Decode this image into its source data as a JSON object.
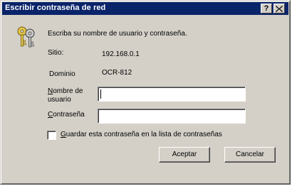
{
  "window": {
    "title": "Escribir contraseña de red",
    "help_button": "?",
    "close_button": "×"
  },
  "instruction": "Escriba su nombre de usuario y contraseña.",
  "site": {
    "label": "Sitio:",
    "value": "192.168.0.1"
  },
  "domain": {
    "label": "Dominio",
    "value": "OCR-812"
  },
  "username": {
    "label_line1_access": "N",
    "label_line1_rest": "ombre de",
    "label_line2": "usuario",
    "value": ""
  },
  "password": {
    "label_access": "C",
    "label_rest": "ontraseña",
    "value": ""
  },
  "save_password": {
    "label_access": "G",
    "label_rest": "uardar esta contraseña en la lista de contraseñas",
    "checked": false
  },
  "buttons": {
    "ok": "Aceptar",
    "cancel": "Cancelar"
  },
  "icon": "keys-icon"
}
